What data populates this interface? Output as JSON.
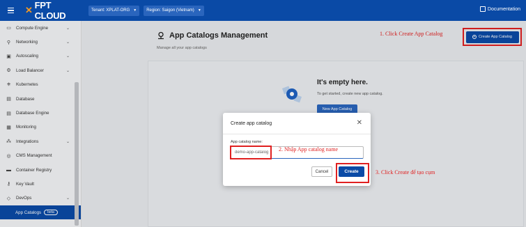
{
  "topbar": {
    "brand": "FPT CLOUD",
    "tenant": "Tenant: XPLAT-ORG",
    "region": "Region: Saigon (Vietnam)",
    "documentation": "Documentation"
  },
  "sidebar": {
    "items": [
      {
        "label": "Compute Engine",
        "icon": "monitor-icon",
        "chevron": true
      },
      {
        "label": "Networking",
        "icon": "network-icon",
        "chevron": true
      },
      {
        "label": "Autoscaling",
        "icon": "autoscaling-icon",
        "chevron": true
      },
      {
        "label": "Load Balancer",
        "icon": "load-balancer-icon",
        "chevron": true
      },
      {
        "label": "Kubernetes",
        "icon": "kubernetes-icon",
        "chevron": false
      },
      {
        "label": "Database",
        "icon": "database-icon",
        "chevron": false
      },
      {
        "label": "Database Engine",
        "icon": "database-engine-icon",
        "chevron": false
      },
      {
        "label": "Monitoring",
        "icon": "monitoring-icon",
        "chevron": false
      },
      {
        "label": "Integrations",
        "icon": "integrations-icon",
        "chevron": true
      },
      {
        "label": "CMS Management",
        "icon": "cms-icon",
        "chevron": false
      },
      {
        "label": "Container Registry",
        "icon": "container-icon",
        "chevron": false
      },
      {
        "label": "Key Vault",
        "icon": "key-icon",
        "chevron": false
      },
      {
        "label": "DevOps",
        "icon": "devops-icon",
        "chevron": true
      }
    ],
    "active": {
      "label": "App Catalogs",
      "badge": "beta"
    }
  },
  "main": {
    "title": "App Catalogs Management",
    "subtitle": "Manage all your app catalogs",
    "create_button": "Create App Catalog",
    "empty_title": "It's empty here.",
    "empty_subtitle": "To get started, create new app catalog.",
    "new_button": "New App Catalog"
  },
  "annotations": {
    "step1": "1. Click Create App Catalog",
    "step2": "2. Nhập App catalog name",
    "step3": "3. Click Create để tạo cụm"
  },
  "modal": {
    "title": "Create app catalog",
    "field_label": "App catalog name:",
    "field_value": "demo-app-catalog",
    "cancel": "Cancel",
    "confirm": "Create"
  },
  "colors": {
    "primary": "#0a4aa6",
    "accent": "#f59a23",
    "annotation": "#e02020"
  }
}
